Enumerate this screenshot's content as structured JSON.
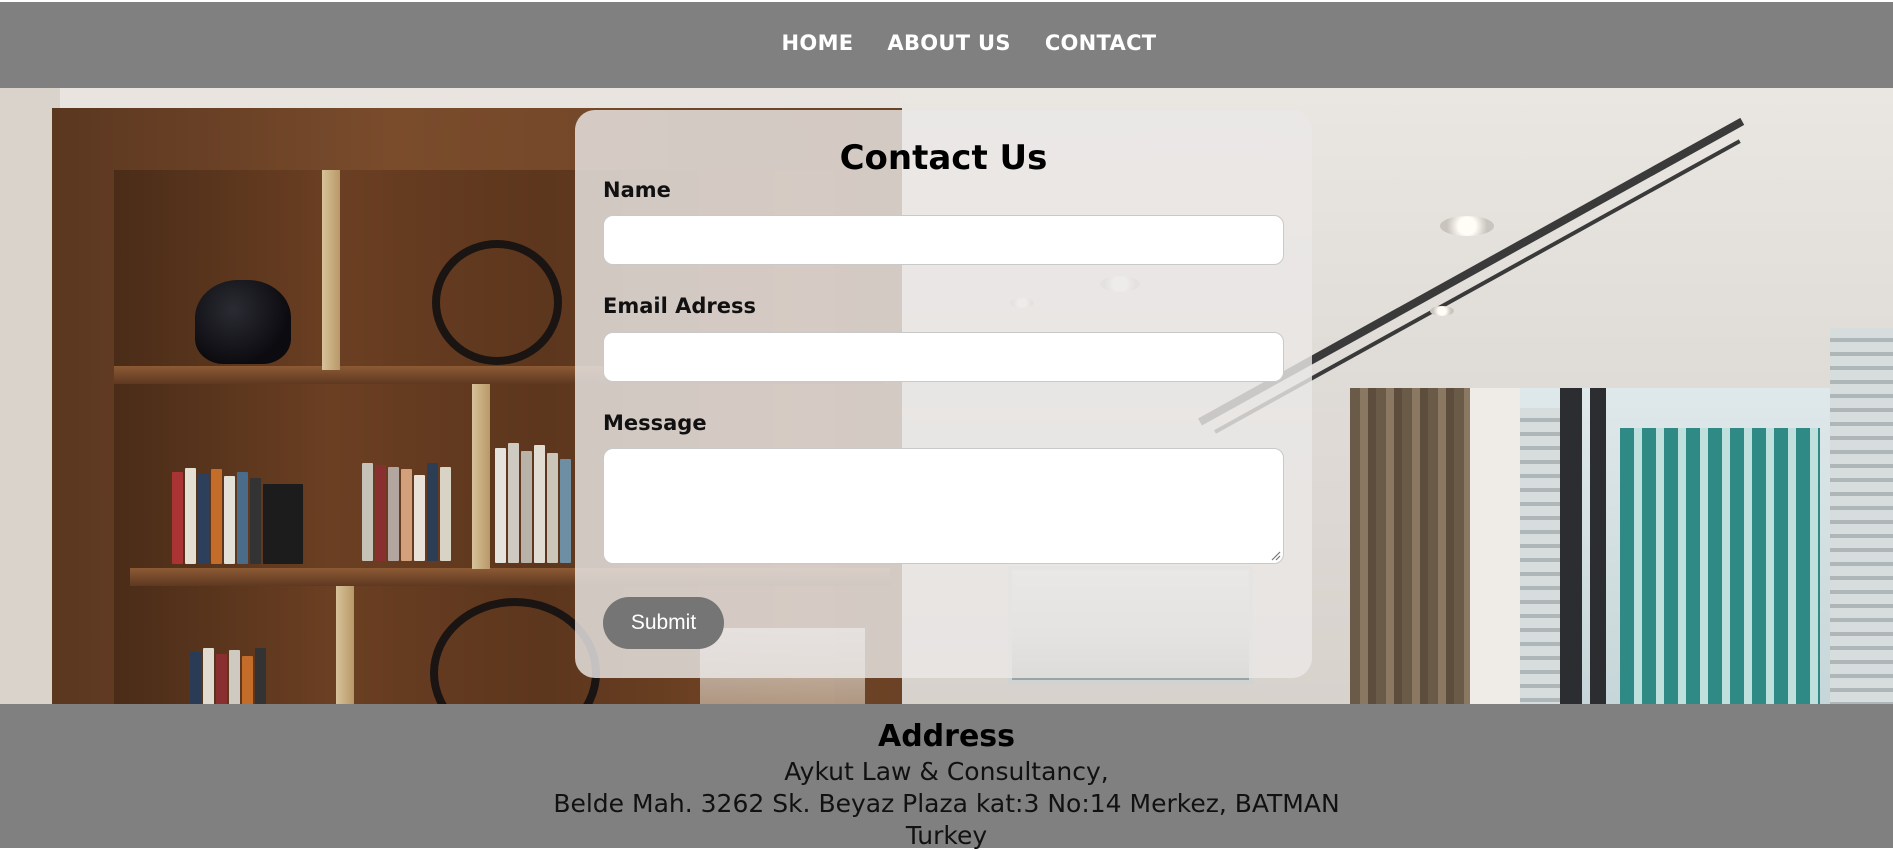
{
  "nav": {
    "items": [
      {
        "label": "HOME"
      },
      {
        "label": "ABOUT US"
      },
      {
        "label": "CONTACT"
      }
    ]
  },
  "contact": {
    "title": "Contact Us",
    "fields": {
      "name_label": "Name",
      "name_value": "",
      "email_label": "Email Adress",
      "email_value": "",
      "message_label": "Message",
      "message_value": ""
    },
    "submit_label": "Submit"
  },
  "footer": {
    "title": "Address",
    "lines": [
      "Aykut Law & Consultancy,",
      "Belde Mah. 3262 Sk. Beyaz Plaza kat:3 No:14 Merkez, BATMAN",
      "Turkey"
    ]
  },
  "colors": {
    "nav_bg": "#808080",
    "footer_bg": "#808080",
    "button_bg": "#757575",
    "card_bg": "#eae8e6"
  }
}
